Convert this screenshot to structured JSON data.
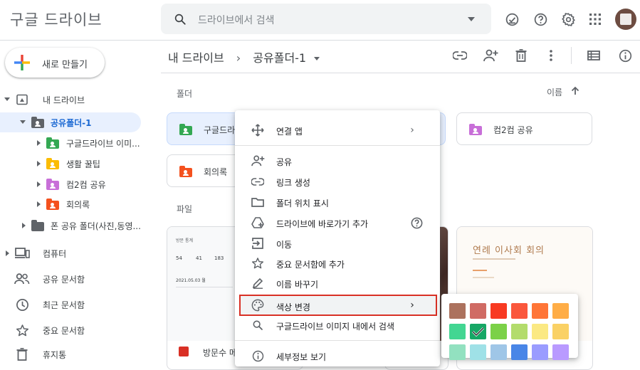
{
  "header": {
    "app_title": "구글 드라이브",
    "search_placeholder": "드라이브에서 검색"
  },
  "sidebar": {
    "new_button": "새로 만들기",
    "tree": [
      {
        "label": "내 드라이브",
        "icon": "my-drive-icon"
      },
      {
        "label": "공유폴더-1",
        "icon": "shared-folder-icon",
        "color": "#5f6368",
        "selected": true
      },
      {
        "label": "구글드라이브 이미...",
        "icon": "shared-folder-icon",
        "color": "#34a853"
      },
      {
        "label": "생활 꿀팁",
        "icon": "shared-folder-icon",
        "color": "#fbbc04"
      },
      {
        "label": "컴2컴 공유",
        "icon": "shared-folder-icon",
        "color": "#c86fd8"
      },
      {
        "label": "회의록",
        "icon": "shared-folder-icon",
        "color": "#f4511e"
      },
      {
        "label": "폰 공유 폴더(사진,동영...",
        "icon": "folder-icon",
        "color": "#5f6368"
      }
    ],
    "nav": [
      {
        "label": "컴퓨터",
        "icon": "computer-icon"
      },
      {
        "label": "공유 문서함",
        "icon": "people-icon"
      },
      {
        "label": "최근 문서함",
        "icon": "clock-icon"
      },
      {
        "label": "중요 문서함",
        "icon": "star-icon"
      },
      {
        "label": "휴지통",
        "icon": "trash-icon"
      }
    ]
  },
  "main": {
    "breadcrumb_root": "내 드라이브",
    "breadcrumb_current": "공유폴더-1",
    "folders_label": "폴더",
    "sort_label": "이름",
    "files_label": "파일",
    "folders": [
      {
        "label": "구글드라이브 이미지",
        "color": "#34a853"
      },
      {
        "label": "컴2컴 공유",
        "color": "#c86fd8"
      },
      {
        "label": "회의록",
        "color": "#f4511e"
      }
    ],
    "files": [
      {
        "doc_header": "방문 통계",
        "stats": [
          "54",
          "41",
          "183"
        ],
        "date": "2021.05.03 월"
      },
      {
        "doc_title": "연례 이사회 회의"
      },
      {
        "name": "방문수 메"
      }
    ]
  },
  "context_menu": {
    "items": [
      {
        "label": "연결 앱",
        "icon": "move-arrows-icon"
      },
      {
        "label": "공유",
        "icon": "add-person-icon"
      },
      {
        "label": "링크 생성",
        "icon": "link-icon"
      },
      {
        "label": "폴더 위치 표시",
        "icon": "folder-outline-icon"
      },
      {
        "label": "드라이브에 바로가기 추가",
        "icon": "drive-shortcut-icon"
      },
      {
        "label": "이동",
        "icon": "move-to-icon"
      },
      {
        "label": "중요 문서함에 추가",
        "icon": "star-outline-icon"
      },
      {
        "label": "이름 바꾸기",
        "icon": "pencil-icon"
      },
      {
        "label": "색상 변경",
        "icon": "palette-icon"
      },
      {
        "label": "구글드라이브 이미지 내에서 검색",
        "icon": "search-icon"
      },
      {
        "label": "세부정보 보기",
        "icon": "info-icon"
      }
    ]
  },
  "palette": {
    "colors": [
      "#ac725e",
      "#d06b64",
      "#f83a22",
      "#fa573c",
      "#ff7537",
      "#ffad46",
      "#42d692",
      "#16a765",
      "#7bd148",
      "#b3dc6c",
      "#fbe983",
      "#fad165",
      "#92e1c0",
      "#9fe1e7",
      "#9fc6e7",
      "#4986e7",
      "#9a9cff",
      "#b99aff"
    ],
    "selected_index": 7
  },
  "colors": {
    "accent": "#1a73e8",
    "selected_bg": "#e8f0fe",
    "highlight_border": "#d93025"
  }
}
